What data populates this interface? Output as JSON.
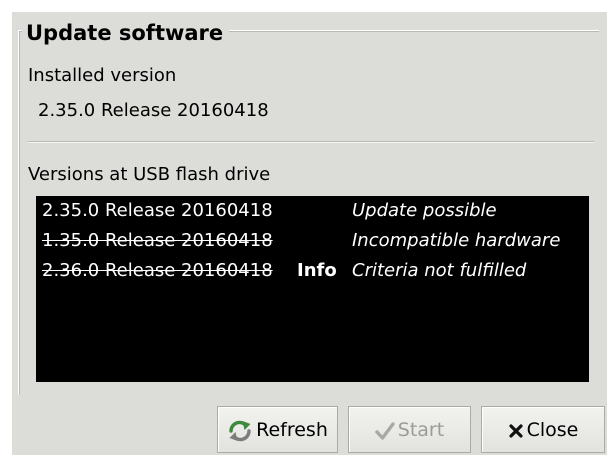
{
  "dialog": {
    "group_title": "Update software",
    "installed_label": "Installed version",
    "installed_value": "2.35.0 Release 20160418",
    "usb_label": "Versions at USB flash drive"
  },
  "versions": [
    {
      "version": "2.35.0 Release 20160418",
      "info": "",
      "status": "Update possible",
      "struck": false
    },
    {
      "version": "1.35.0 Release 20160418",
      "info": "",
      "status": "Incompatible hardware",
      "struck": true
    },
    {
      "version": "2.36.0 Release 20160418",
      "info": "Info",
      "status": "Criteria not fulfilled",
      "struck": true
    }
  ],
  "buttons": {
    "refresh_label": "Refresh",
    "refresh_icon": "refresh-icon",
    "start_label": "Start",
    "start_icon": "checkmark-icon",
    "close_label": "Close",
    "close_icon": "close-icon"
  },
  "colors": {
    "panel_bg": "#dcdcd8",
    "list_bg": "#000000",
    "list_text": "#ffffff",
    "refresh_icon_green": "#3c8a3c",
    "disabled_text": "#9b9b98"
  }
}
